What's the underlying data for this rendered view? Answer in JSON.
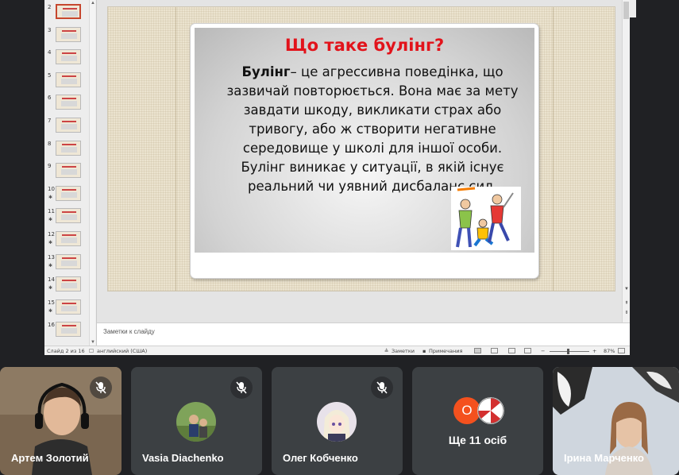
{
  "presentation": {
    "slide_title": "Що таке булінг?",
    "body_term": "Булінг",
    "body_text": "– це агрессивна поведінка, що зазвичай повторюється. Вона має за мету завдати шкоду, викликати страх або тривогу, або ж створити негативне середовище у школі для іншої особи. Булінг виникає у ситуації, в якій існує реальний чи уявний дисбаланс сил.",
    "title_color": "#e2131b",
    "notes_placeholder": "Заметки к слайду",
    "thumbnails": [
      {
        "num": "2",
        "star": false,
        "active": true
      },
      {
        "num": "3",
        "star": false,
        "active": false
      },
      {
        "num": "4",
        "star": false,
        "active": false
      },
      {
        "num": "5",
        "star": false,
        "active": false
      },
      {
        "num": "6",
        "star": false,
        "active": false
      },
      {
        "num": "7",
        "star": false,
        "active": false
      },
      {
        "num": "8",
        "star": false,
        "active": false
      },
      {
        "num": "9",
        "star": false,
        "active": false
      },
      {
        "num": "10",
        "star": true,
        "active": false
      },
      {
        "num": "11",
        "star": true,
        "active": false
      },
      {
        "num": "12",
        "star": true,
        "active": false
      },
      {
        "num": "13",
        "star": true,
        "active": false
      },
      {
        "num": "14",
        "star": true,
        "active": false
      },
      {
        "num": "15",
        "star": true,
        "active": false
      },
      {
        "num": "16",
        "star": false,
        "active": false
      }
    ],
    "status": {
      "slide_info": "Слайд 2 из 16",
      "language": "английский (США)",
      "notes_btn": "Заметки",
      "comments_btn": "Примечания",
      "zoom": "87%",
      "zoom_minus": "−",
      "zoom_plus": "+"
    }
  },
  "participants": [
    {
      "name": "Артем Золотий",
      "muted": true,
      "type": "video"
    },
    {
      "name": "Vasia Diachenko",
      "muted": true,
      "type": "avatar"
    },
    {
      "name": "Олег Кобченко",
      "muted": true,
      "type": "avatar"
    },
    {
      "more_label": "Ще 11 осіб",
      "initial": "О",
      "initial_color": "#f4511e",
      "type": "more"
    },
    {
      "name": "Ірина Марченко",
      "muted": false,
      "type": "video"
    }
  ]
}
